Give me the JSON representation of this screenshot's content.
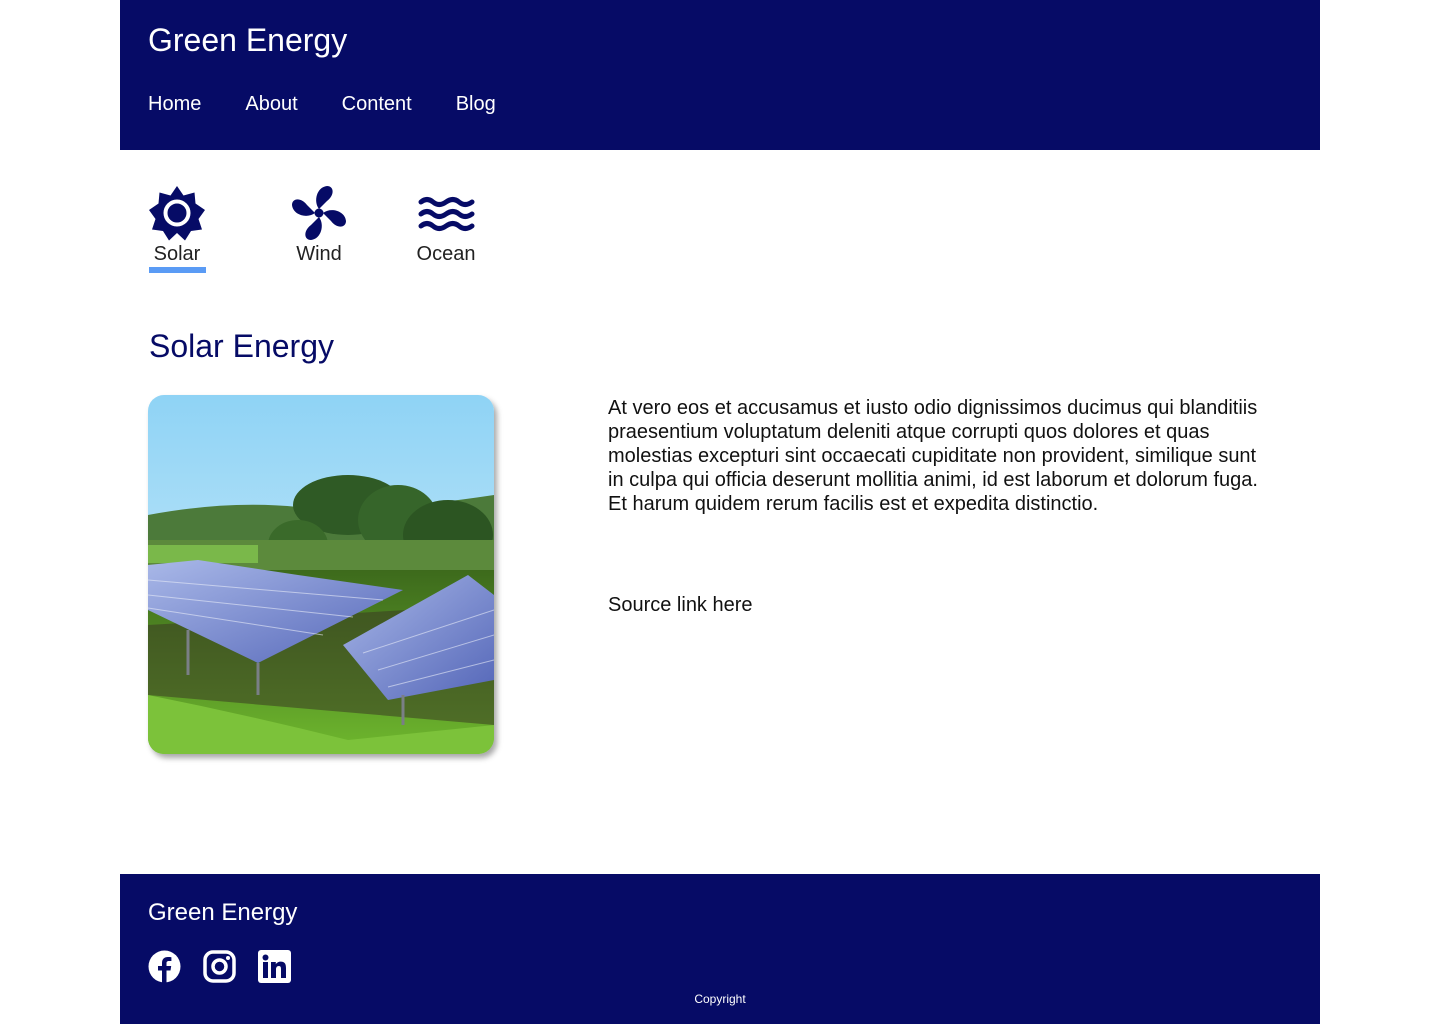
{
  "header": {
    "site_title": "Green Energy",
    "nav": [
      "Home",
      "About",
      "Content",
      "Blog"
    ]
  },
  "tabs": [
    {
      "label": "Solar",
      "icon": "sun-icon",
      "active": true
    },
    {
      "label": "Wind",
      "icon": "fan-icon",
      "active": false
    },
    {
      "label": "Ocean",
      "icon": "waves-icon",
      "active": false
    }
  ],
  "main": {
    "title": "Solar Energy",
    "image_alt": "solar-panels-photo",
    "body": "At vero eos et accusamus et iusto odio dignissimos ducimus qui blanditiis praesentium voluptatum deleniti atque corrupti quos dolores et quas molestias excepturi sint occaecati cupiditate non provident, similique sunt in culpa qui officia deserunt mollitia animi, id est laborum et dolorum fuga. Et harum quidem rerum facilis est et expedita distinctio.",
    "source_link": "Source link here"
  },
  "footer": {
    "title": "Green Energy",
    "social": [
      "facebook-icon",
      "instagram-icon",
      "linkedin-icon"
    ],
    "copyright": "Copyright"
  },
  "colors": {
    "primary": "#060b66",
    "accent": "#5a9bf5",
    "text": "#111111"
  }
}
